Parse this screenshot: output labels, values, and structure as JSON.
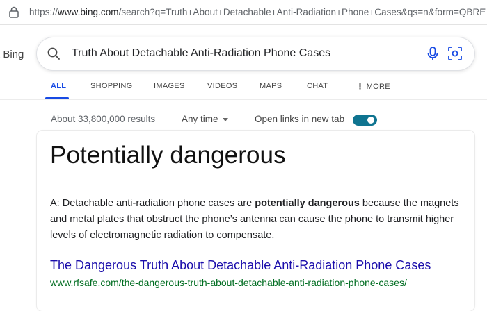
{
  "address_bar": {
    "url_prefix": "https://",
    "url_domain": "www.bing.com",
    "url_path": "/search?q=Truth+About+Detachable+Anti-Radiation+Phone+Cases&qs=n&form=QBRE"
  },
  "header": {
    "brand_text": "t Bing",
    "search_query": "Truth About Detachable Anti-Radiation Phone Cases"
  },
  "tabs": [
    {
      "label": "ALL",
      "active": true
    },
    {
      "label": "SHOPPING"
    },
    {
      "label": "IMAGES"
    },
    {
      "label": "VIDEOS"
    },
    {
      "label": "MAPS"
    },
    {
      "label": "CHAT"
    },
    {
      "label": "MORE"
    }
  ],
  "results_meta": {
    "count": "About 33,800,000 results",
    "time_filter": "Any time",
    "new_tab_label": "Open links in new tab",
    "new_tab_enabled": true
  },
  "answer_card": {
    "headline": "Potentially dangerous",
    "answer_prefix": "A: Detachable anti-radiation phone cases are ",
    "answer_bold": "potentially dangerous",
    "answer_suffix": " because the magnets and metal plates that obstruct the phone’s antenna can cause the phone to transmit higher levels of electromagnetic radiation to compensate.",
    "source_title": "The Dangerous Truth About Detachable Anti-Radiation Phone Cases",
    "source_url": "www.rfsafe.com/the-dangerous-truth-about-detachable-anti-radiation-phone-cases/"
  },
  "colors": {
    "accent_blue": "#174ae4",
    "link_blue": "#1a0dab",
    "url_green": "#006d21",
    "toggle_on": "#0f7490"
  },
  "icons": [
    "lock-icon",
    "search-icon",
    "microphone-icon",
    "visual-search-icon",
    "more-dots-icon"
  ]
}
